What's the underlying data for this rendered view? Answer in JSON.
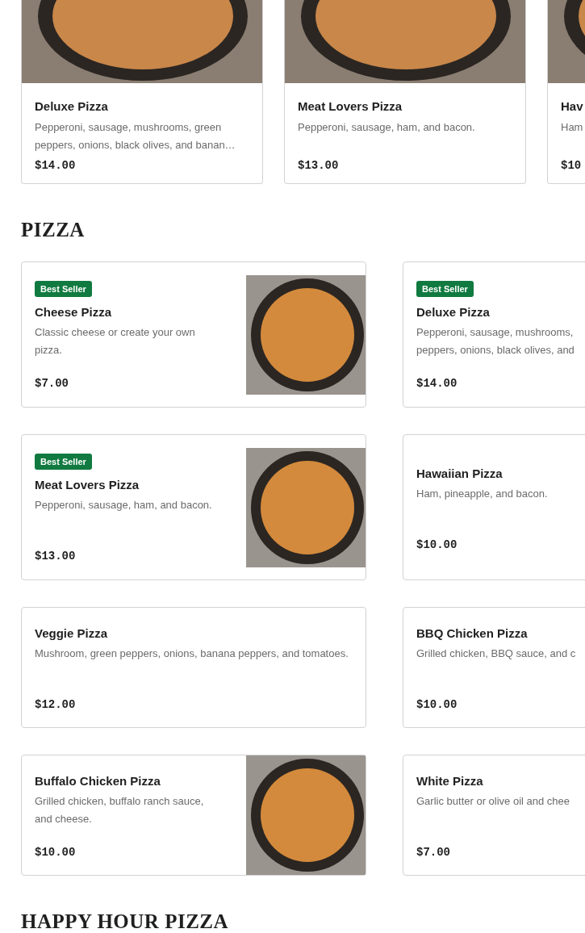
{
  "featured": [
    {
      "name": "Deluxe Pizza",
      "description": "Pepperoni, sausage, mushrooms, green peppers, onions, black olives, and banan…",
      "price": "$14.00"
    },
    {
      "name": "Meat Lovers Pizza",
      "description": "Pepperoni, sausage, ham, and bacon.",
      "price": "$13.00"
    },
    {
      "name": "Hav",
      "description": "Ham",
      "price": "$10"
    }
  ],
  "sections": [
    {
      "title": "PIZZA",
      "items": [
        {
          "badge": "Best Seller",
          "name": "Cheese Pizza",
          "description": "Classic cheese or create your own pizza.",
          "price": "$7.00",
          "photo": true
        },
        {
          "badge": "Best Seller",
          "name": "Deluxe Pizza",
          "description": "Pepperoni, sausage, mushrooms, peppers, onions, black olives, and",
          "price": "$14.00",
          "photo": false
        },
        {
          "badge": "Best Seller",
          "name": "Meat Lovers Pizza",
          "description": "Pepperoni, sausage, ham, and bacon.",
          "price": "$13.00",
          "photo": true
        },
        {
          "name": "Hawaiian Pizza",
          "description": "Ham, pineapple, and bacon.",
          "price": "$10.00",
          "photo": false
        },
        {
          "name": "Veggie Pizza",
          "description": "Mushroom, green peppers, onions, banana peppers, and tomatoes.",
          "price": "$12.00",
          "photo": false
        },
        {
          "name": "BBQ Chicken Pizza",
          "description": "Grilled chicken, BBQ sauce, and c",
          "price": "$10.00",
          "photo": false
        },
        {
          "name": "Buffalo Chicken Pizza",
          "description": "Grilled chicken, buffalo ranch sauce, and cheese.",
          "price": "$10.00",
          "photo": true
        },
        {
          "name": "White Pizza",
          "description": "Garlic butter or olive oil and chee",
          "price": "$7.00",
          "photo": false
        }
      ]
    },
    {
      "title": "HAPPY HOUR PIZZA"
    }
  ]
}
